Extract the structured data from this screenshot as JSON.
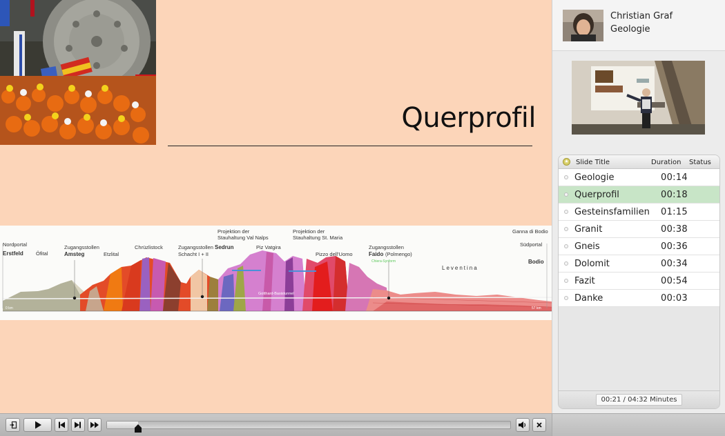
{
  "slide": {
    "title": "Querprofil",
    "profile_labels": {
      "nordportal": "Nordportal",
      "erstfeld": "Erstfeld",
      "ofital": "Öfital",
      "zug1_a": "Zugangsstollen",
      "zug1_b": "Amsteg",
      "etzlital": "Etzlital",
      "chruzlistock": "Chrüzlistock",
      "zug2_a": "Zugangsstollen",
      "zug2_b": "Sedrun",
      "zug2_c": "Schacht I + II",
      "proj1_a": "Projektion der",
      "proj1_b": "Stauhaltung Val Nalps",
      "pizvatgira": "Piz Vatgira",
      "proj2_a": "Projektion der",
      "proj2_b": "Stauhaltung St. Maria",
      "pizzo": "Pizzo dell'Uomo",
      "zug3_a": "Zugangsstollen",
      "zug3_b": "Faido",
      "zug3_c": "(Polmengo)",
      "ganna": "Ganna di Bodio",
      "sudportal": "Südportal",
      "bodio": "Bodio",
      "leventina": "Leventina",
      "tunnel": "Gotthard-Basistunnel",
      "km0": "0 km",
      "km57": "57 km",
      "chiera": "Chiera-Synform"
    }
  },
  "presenter": {
    "name": "Christian Graf",
    "topic": "Geologie"
  },
  "toc": {
    "headers": {
      "title": "Slide Title",
      "duration": "Duration",
      "status": "Status"
    },
    "rows": [
      {
        "title": "Geologie",
        "duration": "00:14"
      },
      {
        "title": "Querprofil",
        "duration": "00:18"
      },
      {
        "title": "Gesteinsfamilien",
        "duration": "01:15"
      },
      {
        "title": "Granit",
        "duration": "00:38"
      },
      {
        "title": "Gneis",
        "duration": "00:36"
      },
      {
        "title": "Dolomit",
        "duration": "00:34"
      },
      {
        "title": "Fazit",
        "duration": "00:54"
      },
      {
        "title": "Danke",
        "duration": "00:03"
      }
    ],
    "active_index": 1,
    "time_readout": "00:21 / 04:32 Minutes"
  },
  "player": {
    "progress": 0.077,
    "buttons": [
      "exit-icon",
      "play-icon",
      "previous-slide-icon",
      "next-slide-icon",
      "fast-forward-icon",
      "volume-icon",
      "close-icon"
    ]
  },
  "colors": {
    "slide_bg": "#fcd5b9",
    "active_row": "#c8e5c7"
  }
}
